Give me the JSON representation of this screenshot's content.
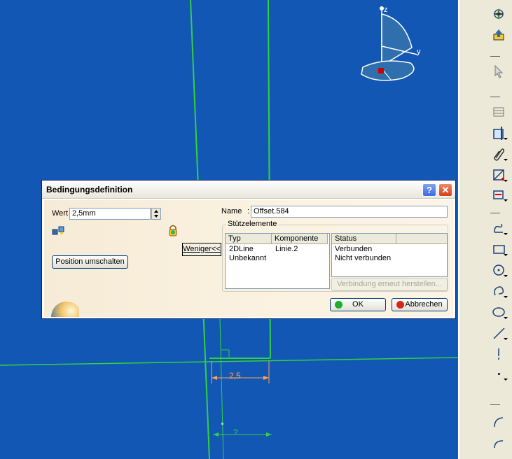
{
  "viewport": {
    "axis_z": "z",
    "axis_y": "y",
    "dimension_offset": "2,5",
    "dimension_lower": "?"
  },
  "toolbar": {
    "icons": [
      "compass-icon",
      "export-icon",
      "select-arrow-icon",
      "profile-icon",
      "cut-part-icon",
      "paperclip-icon",
      "transform-icon",
      "constraint-icon",
      "spline-icon",
      "rectangle-icon",
      "circle-icon",
      "arc-icon",
      "ellipse-icon",
      "line-icon",
      "axis-icon",
      "point-icon",
      "corner-icon",
      "chamfer-icon"
    ]
  },
  "dialog": {
    "title": "Bedingungsdefinition",
    "help_label": "?",
    "close_label": "✕",
    "value_label": "Wert",
    "value": "2,5mm",
    "switch_position_label": "Position umschalten",
    "less_label": "Weniger<<",
    "name_label": "Name",
    "name_value": "Offset.584",
    "support_group_label": "Stützelemente",
    "columns": {
      "type": "Typ",
      "component": "Komponente",
      "status": "Status"
    },
    "rows": [
      {
        "type": "2DLine",
        "component": "Linie.2",
        "status": "Verbunden"
      },
      {
        "type": "Unbekannt",
        "component": "",
        "status": "Nicht verbunden"
      }
    ],
    "reconnect_label": "Verbindung erneut herstellen...",
    "ok_label": "OK",
    "cancel_label": "Abbrechen",
    "colors": {
      "ok_dot": "#1fae2b",
      "cancel_dot": "#d7261a"
    }
  }
}
